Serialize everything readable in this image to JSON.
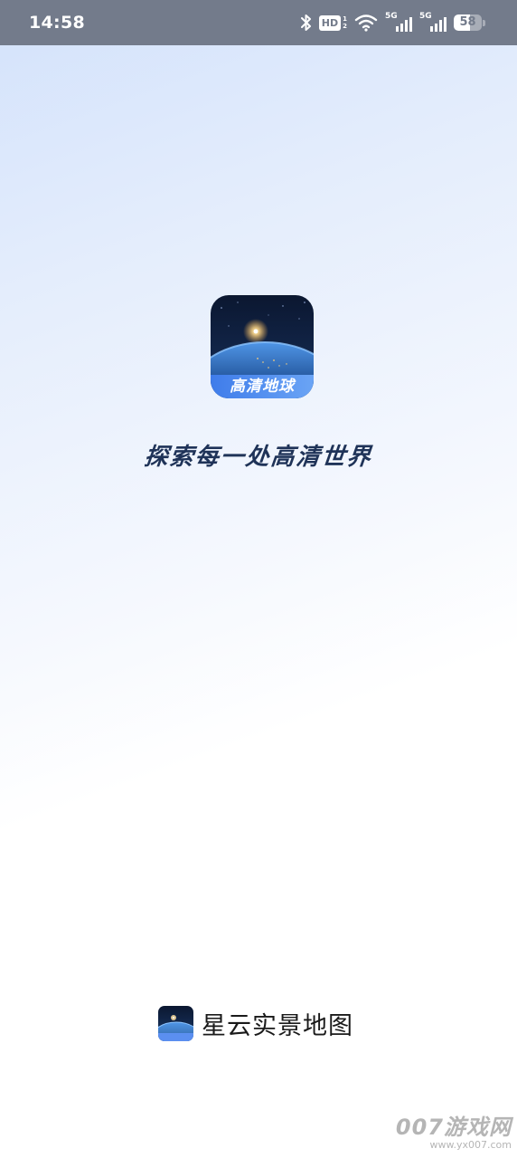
{
  "status_bar": {
    "time": "14:58",
    "hd_label": "HD",
    "hd_sub_top": "1",
    "hd_sub_bottom": "2",
    "network_1_label": "5G",
    "network_2_label": "5G",
    "battery_percent": "58",
    "battery_level": 58,
    "icons": [
      "bluetooth-icon",
      "hd-voice-icon",
      "wifi-icon",
      "signal-icon",
      "signal-icon",
      "battery-icon"
    ]
  },
  "splash": {
    "app_icon_label": "高清地球",
    "slogan": "探索每一处高清世界"
  },
  "brand": {
    "name": "星云实景地图"
  },
  "watermark": {
    "main": "007游戏网",
    "url": "www.yx007.com"
  },
  "colors": {
    "status_bar_bg": "#737b8b",
    "slogan": "#1f3358",
    "icon_label_band": "#5b8ff0"
  }
}
